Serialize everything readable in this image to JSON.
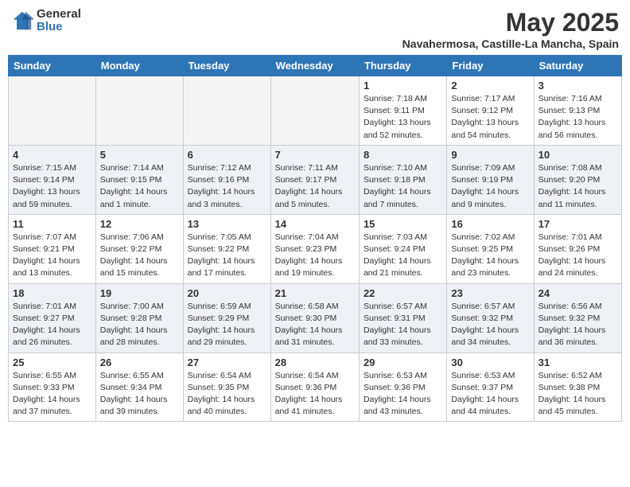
{
  "header": {
    "logo_general": "General",
    "logo_blue": "Blue",
    "month": "May 2025",
    "location": "Navahermosa, Castille-La Mancha, Spain"
  },
  "days_of_week": [
    "Sunday",
    "Monday",
    "Tuesday",
    "Wednesday",
    "Thursday",
    "Friday",
    "Saturday"
  ],
  "weeks": [
    [
      {
        "day": "",
        "empty": true
      },
      {
        "day": "",
        "empty": true
      },
      {
        "day": "",
        "empty": true
      },
      {
        "day": "",
        "empty": true
      },
      {
        "day": "1",
        "sunrise": "7:18 AM",
        "sunset": "9:11 PM",
        "daylight": "13 hours and 52 minutes."
      },
      {
        "day": "2",
        "sunrise": "7:17 AM",
        "sunset": "9:12 PM",
        "daylight": "13 hours and 54 minutes."
      },
      {
        "day": "3",
        "sunrise": "7:16 AM",
        "sunset": "9:13 PM",
        "daylight": "13 hours and 56 minutes."
      }
    ],
    [
      {
        "day": "4",
        "sunrise": "7:15 AM",
        "sunset": "9:14 PM",
        "daylight": "13 hours and 59 minutes."
      },
      {
        "day": "5",
        "sunrise": "7:14 AM",
        "sunset": "9:15 PM",
        "daylight": "14 hours and 1 minute."
      },
      {
        "day": "6",
        "sunrise": "7:12 AM",
        "sunset": "9:16 PM",
        "daylight": "14 hours and 3 minutes."
      },
      {
        "day": "7",
        "sunrise": "7:11 AM",
        "sunset": "9:17 PM",
        "daylight": "14 hours and 5 minutes."
      },
      {
        "day": "8",
        "sunrise": "7:10 AM",
        "sunset": "9:18 PM",
        "daylight": "14 hours and 7 minutes."
      },
      {
        "day": "9",
        "sunrise": "7:09 AM",
        "sunset": "9:19 PM",
        "daylight": "14 hours and 9 minutes."
      },
      {
        "day": "10",
        "sunrise": "7:08 AM",
        "sunset": "9:20 PM",
        "daylight": "14 hours and 11 minutes."
      }
    ],
    [
      {
        "day": "11",
        "sunrise": "7:07 AM",
        "sunset": "9:21 PM",
        "daylight": "14 hours and 13 minutes."
      },
      {
        "day": "12",
        "sunrise": "7:06 AM",
        "sunset": "9:22 PM",
        "daylight": "14 hours and 15 minutes."
      },
      {
        "day": "13",
        "sunrise": "7:05 AM",
        "sunset": "9:22 PM",
        "daylight": "14 hours and 17 minutes."
      },
      {
        "day": "14",
        "sunrise": "7:04 AM",
        "sunset": "9:23 PM",
        "daylight": "14 hours and 19 minutes."
      },
      {
        "day": "15",
        "sunrise": "7:03 AM",
        "sunset": "9:24 PM",
        "daylight": "14 hours and 21 minutes."
      },
      {
        "day": "16",
        "sunrise": "7:02 AM",
        "sunset": "9:25 PM",
        "daylight": "14 hours and 23 minutes."
      },
      {
        "day": "17",
        "sunrise": "7:01 AM",
        "sunset": "9:26 PM",
        "daylight": "14 hours and 24 minutes."
      }
    ],
    [
      {
        "day": "18",
        "sunrise": "7:01 AM",
        "sunset": "9:27 PM",
        "daylight": "14 hours and 26 minutes."
      },
      {
        "day": "19",
        "sunrise": "7:00 AM",
        "sunset": "9:28 PM",
        "daylight": "14 hours and 28 minutes."
      },
      {
        "day": "20",
        "sunrise": "6:59 AM",
        "sunset": "9:29 PM",
        "daylight": "14 hours and 29 minutes."
      },
      {
        "day": "21",
        "sunrise": "6:58 AM",
        "sunset": "9:30 PM",
        "daylight": "14 hours and 31 minutes."
      },
      {
        "day": "22",
        "sunrise": "6:57 AM",
        "sunset": "9:31 PM",
        "daylight": "14 hours and 33 minutes."
      },
      {
        "day": "23",
        "sunrise": "6:57 AM",
        "sunset": "9:32 PM",
        "daylight": "14 hours and 34 minutes."
      },
      {
        "day": "24",
        "sunrise": "6:56 AM",
        "sunset": "9:32 PM",
        "daylight": "14 hours and 36 minutes."
      }
    ],
    [
      {
        "day": "25",
        "sunrise": "6:55 AM",
        "sunset": "9:33 PM",
        "daylight": "14 hours and 37 minutes."
      },
      {
        "day": "26",
        "sunrise": "6:55 AM",
        "sunset": "9:34 PM",
        "daylight": "14 hours and 39 minutes."
      },
      {
        "day": "27",
        "sunrise": "6:54 AM",
        "sunset": "9:35 PM",
        "daylight": "14 hours and 40 minutes."
      },
      {
        "day": "28",
        "sunrise": "6:54 AM",
        "sunset": "9:36 PM",
        "daylight": "14 hours and 41 minutes."
      },
      {
        "day": "29",
        "sunrise": "6:53 AM",
        "sunset": "9:36 PM",
        "daylight": "14 hours and 43 minutes."
      },
      {
        "day": "30",
        "sunrise": "6:53 AM",
        "sunset": "9:37 PM",
        "daylight": "14 hours and 44 minutes."
      },
      {
        "day": "31",
        "sunrise": "6:52 AM",
        "sunset": "9:38 PM",
        "daylight": "14 hours and 45 minutes."
      }
    ]
  ],
  "row_bg": [
    "#ffffff",
    "#eef2f7",
    "#ffffff",
    "#eef2f7",
    "#ffffff"
  ],
  "row_bg_empty": [
    "#f5f5f5",
    "#e5eaf0",
    "#f5f5f5",
    "#e5eaf0",
    "#f5f5f5"
  ]
}
